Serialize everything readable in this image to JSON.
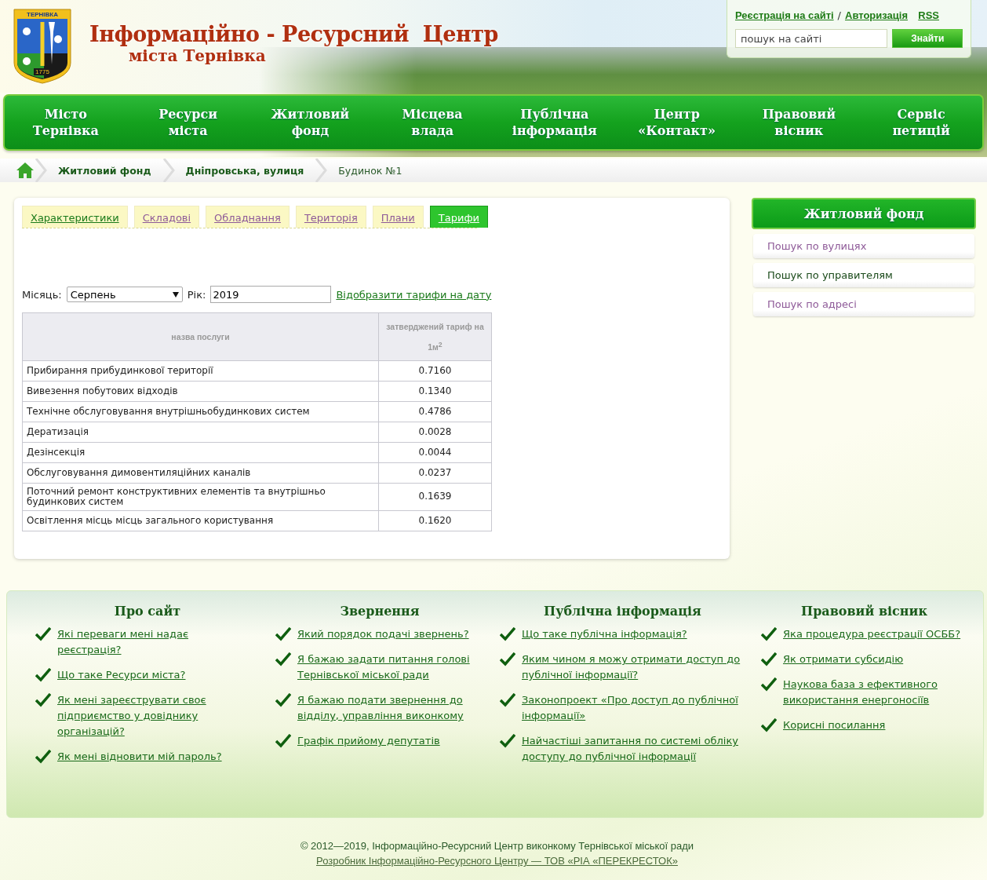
{
  "header": {
    "logo": {
      "top_text": "ТЕРНІВКА",
      "year": "1775"
    },
    "title": "Інформаційно - Ресурсний  Центр",
    "subtitle": "міста Тернівка",
    "account_links": [
      "Реєстрація на сайті",
      "Авторизація"
    ],
    "separator": "/",
    "rss": "RSS",
    "search": {
      "placeholder": "пошук на сайті",
      "button": "Знайти"
    }
  },
  "nav": [
    {
      "label": "Місто Тернівка"
    },
    {
      "label": "Ресурси міста"
    },
    {
      "label": "Житловий фонд"
    },
    {
      "label": "Місцева влада"
    },
    {
      "label": "Публічна інформація"
    },
    {
      "label": "Центр «Контакт»"
    },
    {
      "label": "Правовий вісник"
    },
    {
      "label": "Сервіс петицій"
    }
  ],
  "breadcrumbs": [
    {
      "label": "Житловий фонд",
      "current": false
    },
    {
      "label": "Дніпровська, вулиця",
      "current": false
    },
    {
      "label": "Будинок №1",
      "current": true
    }
  ],
  "tabs": [
    {
      "label": "Характеристики",
      "selected": false,
      "visited": false
    },
    {
      "label": "Складові",
      "selected": false,
      "visited": true
    },
    {
      "label": "Обладнання",
      "selected": false,
      "visited": true
    },
    {
      "label": "Територія",
      "selected": false,
      "visited": true
    },
    {
      "label": "Плани",
      "selected": false,
      "visited": true
    },
    {
      "label": "Тарифи",
      "selected": true,
      "visited": false
    }
  ],
  "filter": {
    "month_label": "Місяць:",
    "month": "Серпень",
    "year_label": "Рік:",
    "year": "2019",
    "link": "Відобразити тарифи на дату"
  },
  "table": {
    "columns": [
      "назва послуги",
      "затверджений тариф на 1м$^{2}$"
    ],
    "rows": [
      [
        "Прибирання прибудинкової території",
        "0.7160"
      ],
      [
        "Вивезення побутових відходів",
        "0.1340"
      ],
      [
        "Технічне обслуговування внутрішньобудинкових систем",
        "0.4786"
      ],
      [
        "Дератизація",
        "0.0028"
      ],
      [
        "Дезінсекція",
        "0.0044"
      ],
      [
        "Обслуговування димовентиляційних каналів",
        "0.0237"
      ],
      [
        "Поточний ремонт конструктивних елементів та внутрішньо будинкових систем",
        "0.1639"
      ],
      [
        "Освітлення місць місць загального користування",
        "0.1620"
      ]
    ]
  },
  "sidebar": {
    "title": "Житловий фонд",
    "items": [
      {
        "label": "Пошук по вулицях",
        "visited": true
      },
      {
        "label": "Пошук по управителям",
        "visited": false
      },
      {
        "label": "Пошук по адресі",
        "visited": true
      }
    ]
  },
  "footer": {
    "columns": [
      {
        "title": "Про сайт",
        "links": [
          "Які переваги мені надає реєстрація?",
          "Що таке Ресурси міста?",
          "Як мені зареєструвати своє підприємство у довіднику організацій?",
          "Як мені відновити мій пароль?"
        ]
      },
      {
        "title": "Звернення",
        "links": [
          "Який порядок подачі звернень?",
          "Я бажаю задати питання голові Тернівської міської ради",
          "Я бажаю подати звернення до відділу, управління виконкому",
          "Графік прийому депутатів"
        ]
      },
      {
        "title": "Публічна інформація",
        "links": [
          "Що таке публічна інформація?",
          "Яким чином я можу отримати доступ до публічної інформації?",
          "Законопроект «Про доступ до публічної інформації»",
          "Найчастіші запитання по системі обліку доступу до публічної інформації"
        ]
      },
      {
        "title": "Правовий вісник",
        "links": [
          "Яка процедура реєстрації ОСББ?",
          "Як отримати субсидію",
          "Наукова база з ефективного використання енергоносіїв",
          "Корисні посилання"
        ]
      }
    ],
    "copyright": "© 2012—2019, Інформаційно-Ресурсний Центр виконкому Тернівської міської ради",
    "developer": "Розробник Інформаційно-Ресурсного Центру — ТОВ «РІА «ПЕРЕКРЕСТОК»"
  }
}
